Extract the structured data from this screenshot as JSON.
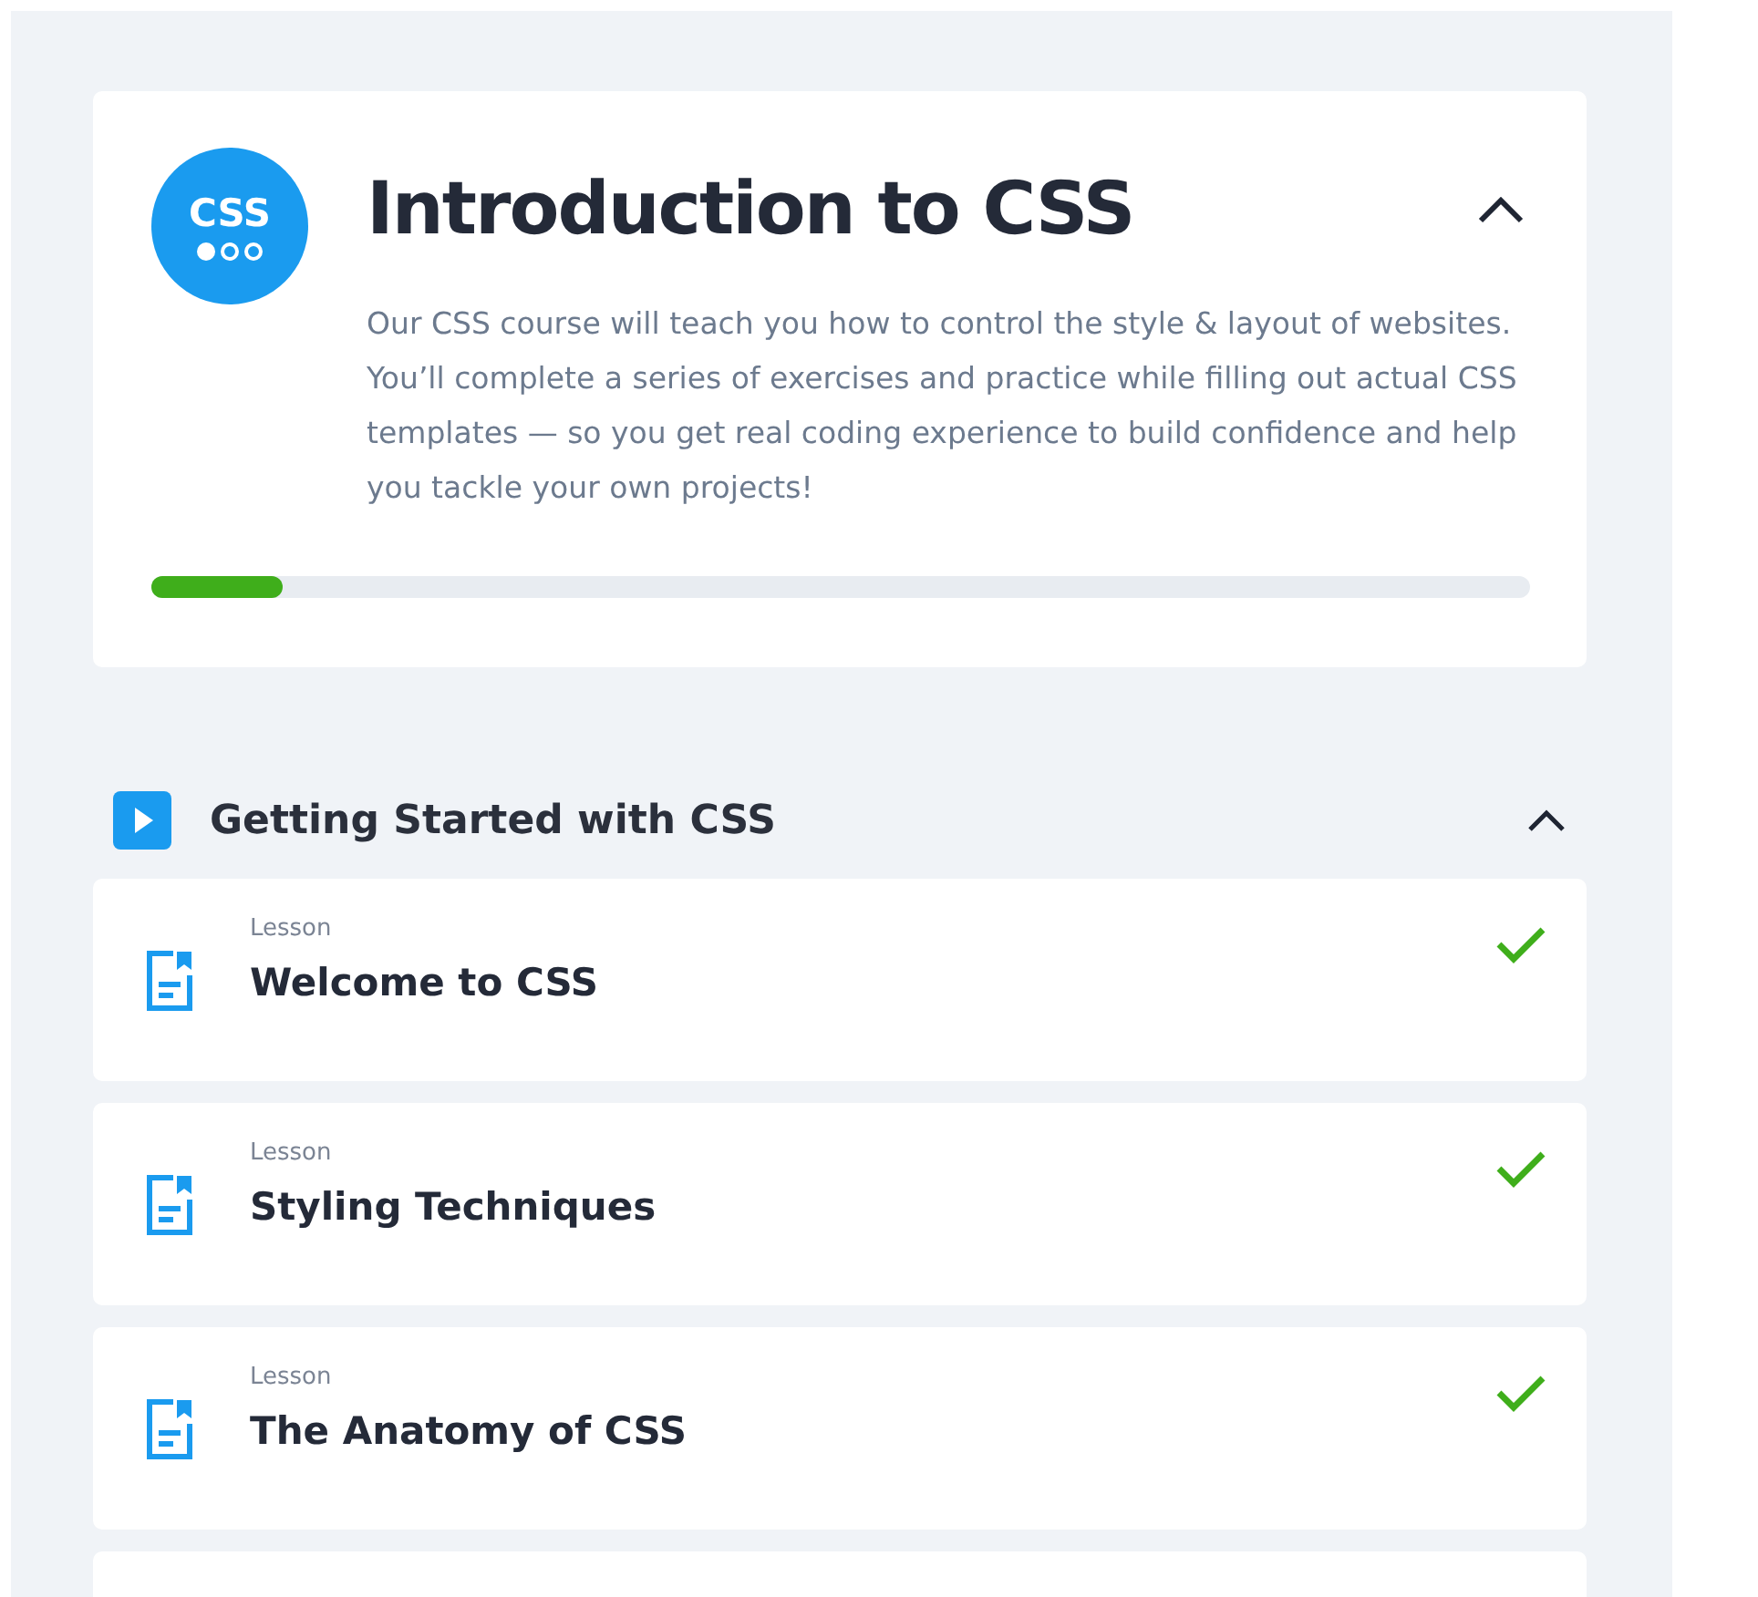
{
  "course": {
    "logo_text": "CSS",
    "title": "Introduction to CSS",
    "expanded": true,
    "description": "Our CSS course will teach you how to control the style & layout of websites. You’ll complete a series of exercises and practice while filling out actual CSS templates — so you get real coding experience to build confidence and help you tackle your own projects!",
    "progress": {
      "level": 0.095
    }
  },
  "section": {
    "title": "Getting Started with CSS",
    "expanded": true,
    "lessons": [
      {
        "type": "Lesson",
        "title": "Welcome to CSS",
        "completed": true
      },
      {
        "type": "Lesson",
        "title": "Styling Techniques",
        "completed": true
      },
      {
        "type": "Lesson",
        "title": "The Anatomy of CSS",
        "completed": true
      }
    ]
  }
}
